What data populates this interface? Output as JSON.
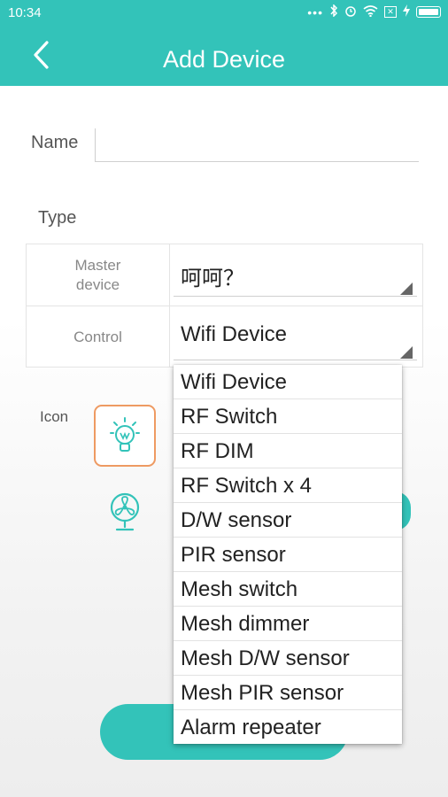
{
  "status_bar": {
    "time": "10:34",
    "icons": [
      "more-dots-icon",
      "bluetooth-icon",
      "alarm-icon",
      "wifi-icon",
      "sim-x-icon",
      "charging-icon",
      "battery-icon"
    ]
  },
  "header": {
    "title": "Add Device",
    "back_icon": "chevron-left-icon"
  },
  "form": {
    "name_label": "Name",
    "name_value": "",
    "type_label": "Type",
    "master_device_label": "Master\ndevice",
    "master_device_value": "呵呵？",
    "control_label": "Control",
    "control_value": "Wifi Device",
    "icon_label": "Icon"
  },
  "dropdown": {
    "options": [
      "Wifi Device",
      "RF Switch",
      "RF DIM",
      "RF Switch x 4",
      "D/W sensor",
      "PIR sensor",
      "Mesh switch",
      "Mesh dimmer",
      "Mesh D/W sensor",
      "Mesh PIR sensor",
      "Alarm repeater"
    ]
  },
  "icons": {
    "selected_icon": "light-bulb-icon",
    "second_icon": "fan-icon"
  },
  "colors": {
    "accent": "#33c3b9",
    "selected_border": "#ee9a62"
  }
}
